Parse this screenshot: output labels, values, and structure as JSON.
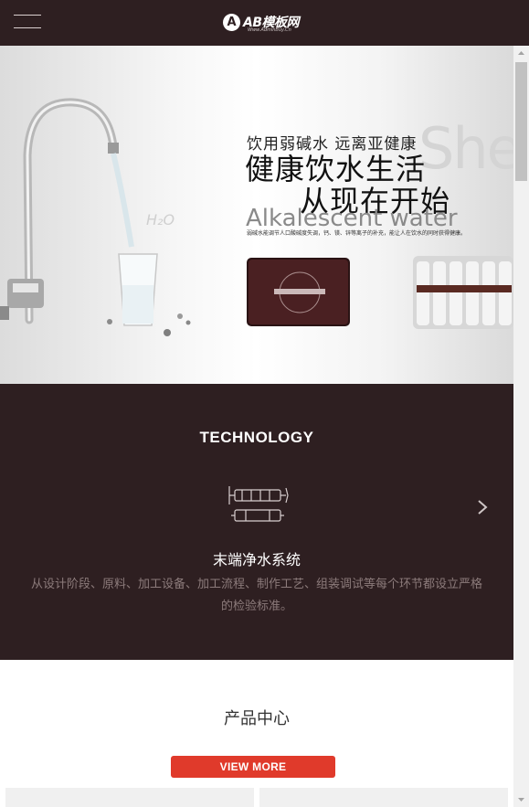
{
  "header": {
    "logo_badge": "A",
    "logo_name": "AB模板网",
    "logo_sub": "Www.AdminBuy.Cn"
  },
  "banner": {
    "line1": "饮用弱碱水 远离亚健康",
    "line2": "健康饮水生活",
    "line3": "从现在开始",
    "en": "Alkalescent water",
    "watermark": "She",
    "small_text": "弱碱水能调节人口酸碱度失调，钙、镁、锌等离子的补充，能让人在饮水的同时获得健康。"
  },
  "technology": {
    "title": "TECHNOLOGY",
    "item_name": "末端净水系统",
    "item_desc": "从设计阶段、原料、加工设备、加工流程、制作工艺、组装调试等每个环节都设立严格的检验标准。"
  },
  "products": {
    "title": "产品中心",
    "view_more": "VIEW MORE"
  },
  "colors": {
    "dark_bg": "#2e1f21",
    "accent": "#e03a2b",
    "desc_text": "#8c7b7b"
  },
  "icons": [
    "menu-icon",
    "filter-cartridge-icon",
    "chevron-right-icon"
  ]
}
